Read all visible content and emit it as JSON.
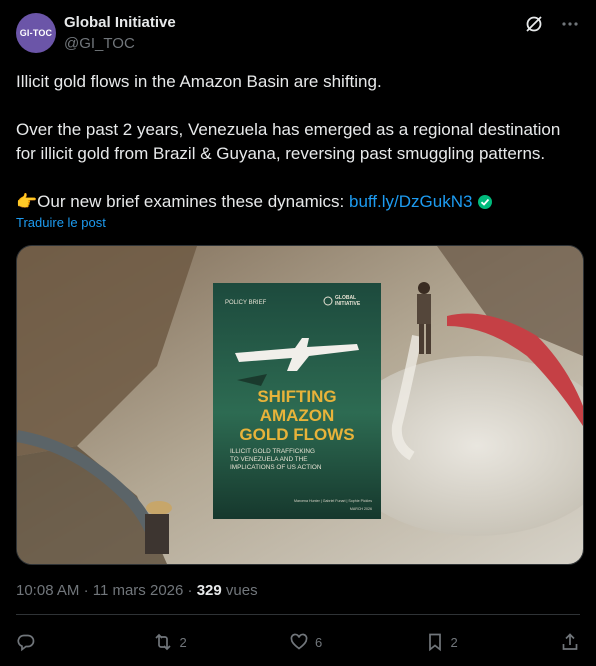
{
  "account": {
    "avatar_text": "GI-TOC",
    "name": "Global Initiative",
    "handle": "@GI_TOC"
  },
  "post": {
    "line1": "Illicit gold flows in the Amazon Basin are shifting.",
    "line2": "Over the past 2 years, Venezuela has emerged as a regional destination for illicit gold from Brazil & Guyana, reversing past smuggling patterns.",
    "line3_prefix": "Our new brief examines these dynamics: ",
    "emoji": "👉",
    "link": "buff.ly/DzGukN3",
    "translate_label": "Traduire le post"
  },
  "media": {
    "brief_label": "POLICY BRIEF",
    "brand_line1": "GLOBAL",
    "brand_line2": "INITIATIVE",
    "title_line1": "SHIFTING",
    "title_line2": "AMAZON",
    "title_line3": "GOLD FLOWS",
    "subtitle_line1": "ILLICIT GOLD TRAFFICKING",
    "subtitle_line2": "TO VENEZUELA AND THE",
    "subtitle_line3": "IMPLICATIONS OF US ACTION",
    "authors": "Marcena Hunter | Gabriel Funari | Sophie Pickles",
    "date": "MARCH 2026"
  },
  "meta": {
    "time": "10:08 AM",
    "separator": "·",
    "date": "11 mars 2026",
    "views_count": "329",
    "views_label": "vues"
  },
  "actions": {
    "reply_count": "",
    "repost_count": "2",
    "like_count": "6",
    "bookmark_count": "2"
  },
  "colors": {
    "background": "#000000",
    "accent": "#1d9bf0",
    "muted": "#71767b",
    "verified": "#00ba7c",
    "cover_title": "#e8b33a"
  }
}
